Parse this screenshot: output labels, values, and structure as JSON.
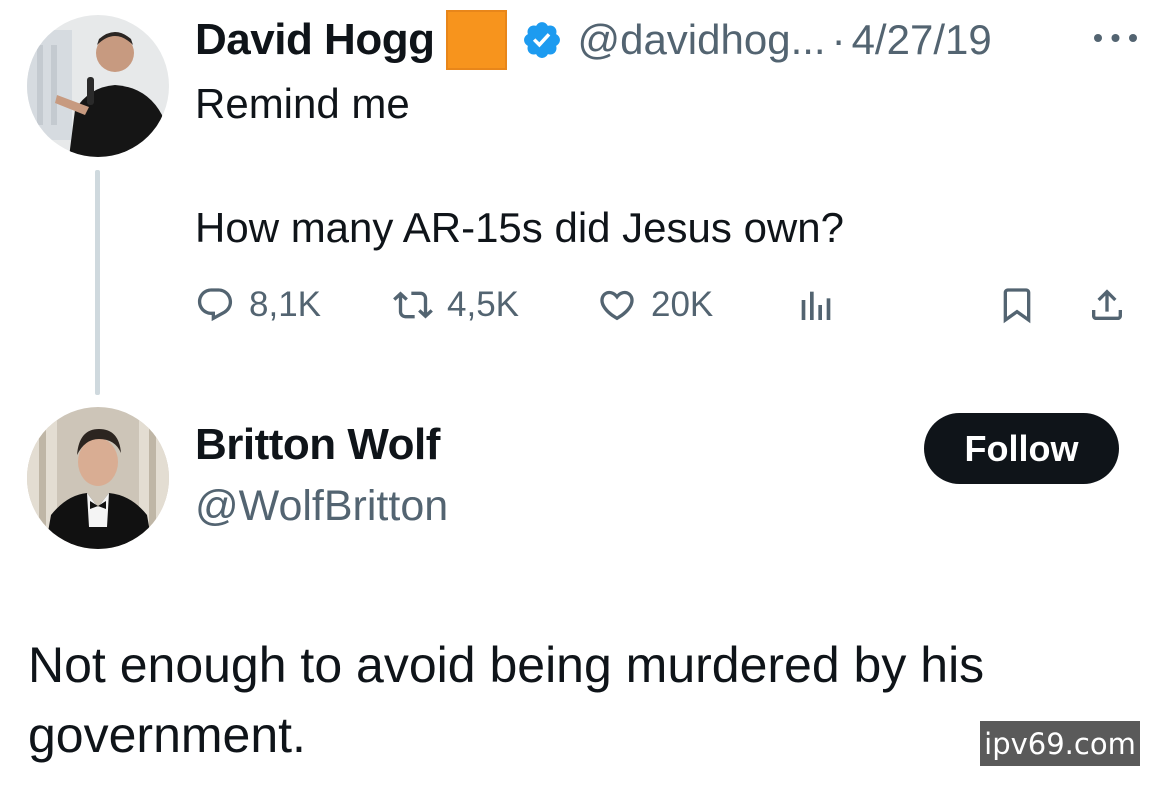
{
  "original_tweet": {
    "author": {
      "display_name": "David Hogg",
      "handle": "@davidhog...",
      "verified": true
    },
    "separator": "·",
    "date": "4/27/19",
    "text_lines": [
      "Remind me",
      "How many AR-15s did Jesus own?"
    ],
    "stats": {
      "replies": "8,1K",
      "retweets": "4,5K",
      "likes": "20K"
    }
  },
  "reply_tweet": {
    "author": {
      "display_name": "Britton Wolf",
      "handle": "@WolfBritton"
    },
    "follow_label": "Follow",
    "text": "Not enough to avoid being murdered by his government."
  },
  "watermark": "ipv69.com",
  "icons": {
    "more": "more-horizontal-icon",
    "reply": "reply-bubble-icon",
    "retweet": "retweet-icon",
    "like": "heart-icon",
    "views": "bar-chart-icon",
    "bookmark": "bookmark-icon",
    "share": "share-icon",
    "verified": "verified-badge-icon"
  },
  "colors": {
    "text": "#0f1419",
    "secondary": "#536471",
    "verified": "#1d9bf0",
    "follow_bg": "#0f1419",
    "orange_square": "#f7941d",
    "thread_line": "#cfd9de"
  }
}
